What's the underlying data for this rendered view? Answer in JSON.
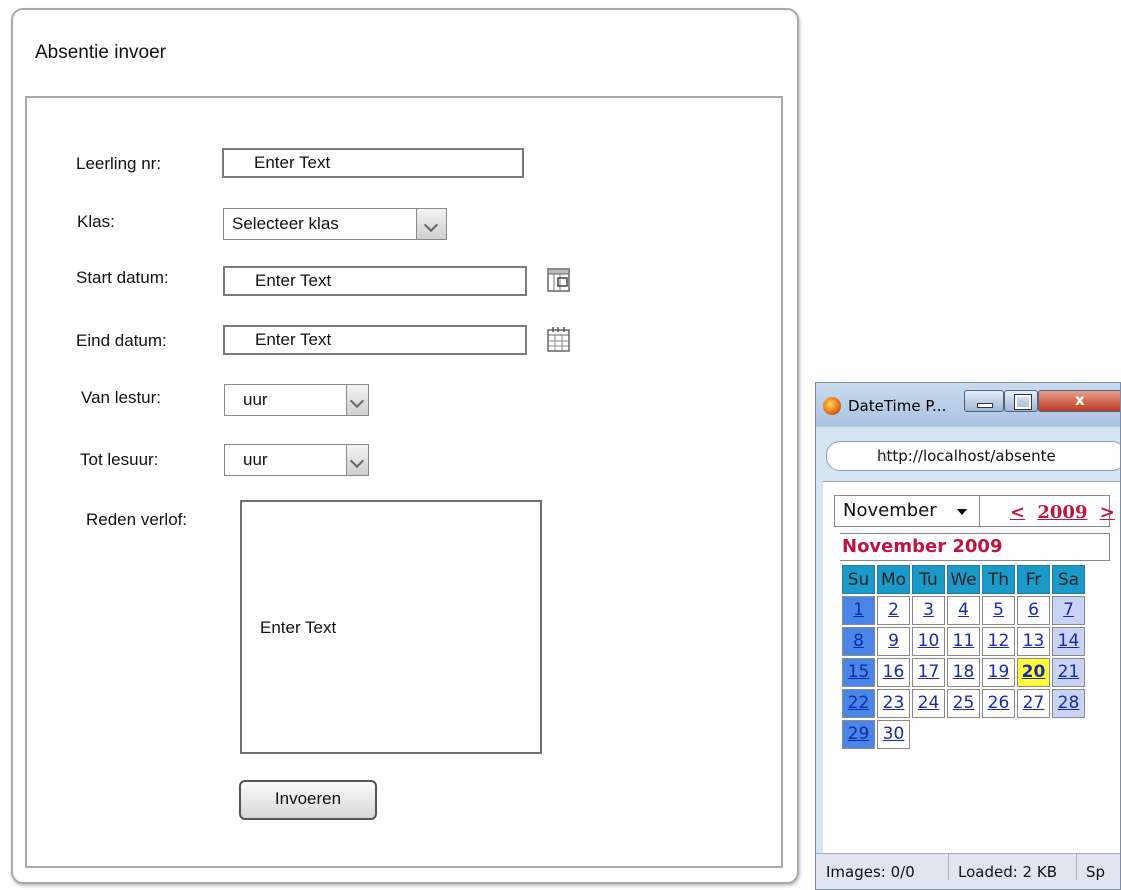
{
  "form": {
    "title": "Absentie invoer",
    "fields": {
      "leerling_label": "Leerling nr:",
      "leerling_value": "Enter Text",
      "klas_label": "Klas:",
      "klas_value": "Selecteer klas",
      "start_label": "Start datum:",
      "start_value": "Enter Text",
      "eind_label": "Eind datum:",
      "eind_value": "Enter Text",
      "van_label": "Van lestur:",
      "van_value": "uur",
      "tot_label": "Tot lesuur:",
      "tot_value": "uur",
      "reden_label": "Reden verlof:",
      "reden_value": "Enter Text"
    },
    "submit_label": "Invoeren"
  },
  "popup": {
    "window_title": "DateTime P...",
    "close_glyph": "x",
    "url": "http://localhost/absente",
    "month_select": "November",
    "prev": "<",
    "year": "2009",
    "next": ">",
    "calendar_title": "November 2009",
    "weekdays": [
      "Su",
      "Mo",
      "Tu",
      "We",
      "Th",
      "Fr",
      "Sa"
    ],
    "days": [
      "1",
      "2",
      "3",
      "4",
      "5",
      "6",
      "7",
      "8",
      "9",
      "10",
      "11",
      "12",
      "13",
      "14",
      "15",
      "16",
      "17",
      "18",
      "19",
      "20",
      "21",
      "22",
      "23",
      "24",
      "25",
      "26",
      "27",
      "28",
      "29",
      "30"
    ],
    "today": "20",
    "status": {
      "images": "Images: 0/0",
      "loaded": "Loaded: 2 KB",
      "speed": "Sp"
    }
  },
  "colors": {
    "weekday_header": "#1a9ac8",
    "sunday": "#4a86e8",
    "saturday": "#c9d3f5",
    "today": "#ffff33",
    "accent_red": "#c0143c"
  }
}
